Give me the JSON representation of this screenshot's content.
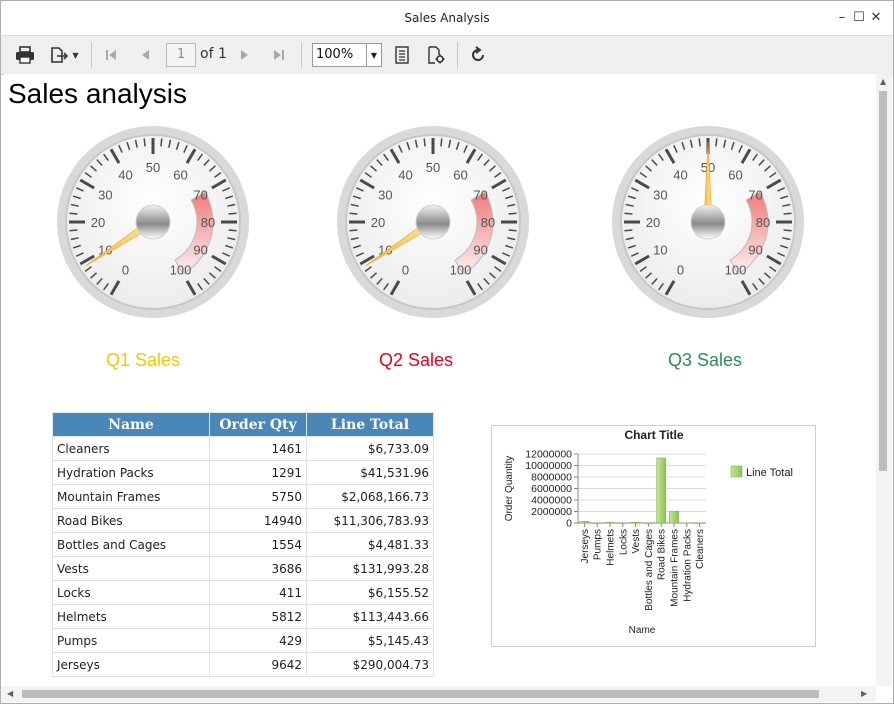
{
  "window": {
    "title": "Sales Analysis"
  },
  "toolbar": {
    "page_current": "1",
    "page_of": "of 1",
    "zoom": "100%"
  },
  "report": {
    "title": "Sales analysis",
    "gauges": [
      {
        "caption": "Q1 Sales",
        "value": 9,
        "caption_color": "#f5c800"
      },
      {
        "caption": "Q2 Sales",
        "value": 9,
        "caption_color": "#e4001b"
      },
      {
        "caption": "Q3 Sales",
        "value": 50,
        "caption_color": "#2e8b57"
      }
    ],
    "gauge_scale": {
      "min": 0,
      "max": 100,
      "labels": [
        "0",
        "10",
        "20",
        "30",
        "40",
        "50",
        "60",
        "70",
        "80",
        "90",
        "100"
      ],
      "range_start": 70,
      "range_end": 100
    },
    "table": {
      "headers": [
        "Name",
        "Order Qty",
        "Line Total"
      ],
      "rows": [
        [
          "Cleaners",
          "1461",
          "$6,733.09"
        ],
        [
          "Hydration Packs",
          "1291",
          "$41,531.96"
        ],
        [
          "Mountain Frames",
          "5750",
          "$2,068,166.73"
        ],
        [
          "Road Bikes",
          "14940",
          "$11,306,783.93"
        ],
        [
          "Bottles and Cages",
          "1554",
          "$4,481.33"
        ],
        [
          "Vests",
          "3686",
          "$131,993.28"
        ],
        [
          "Locks",
          "411",
          "$6,155.52"
        ],
        [
          "Helmets",
          "5812",
          "$113,443.66"
        ],
        [
          "Pumps",
          "429",
          "$5,145.43"
        ],
        [
          "Jerseys",
          "9642",
          "$290,004.73"
        ]
      ]
    }
  },
  "chart_data": {
    "type": "bar",
    "title": "Chart Title",
    "xlabel": "Name",
    "ylabel": "Order Quantity",
    "categories": [
      "Jerseys",
      "Pumps",
      "Helmets",
      "Locks",
      "Vests",
      "Bottles and Cages",
      "Road Bikes",
      "Mountain Frames",
      "Hydration Packs",
      "Cleaners"
    ],
    "series": [
      {
        "name": "Line Total",
        "values": [
          290004.73,
          5145.43,
          113443.66,
          6155.52,
          131993.28,
          4481.33,
          11306783.93,
          2068166.73,
          41531.96,
          6733.09
        ]
      }
    ],
    "yticks": [
      "0",
      "2000000",
      "4000000",
      "6000000",
      "8000000",
      "10000000",
      "12000000"
    ],
    "ylim": [
      0,
      12000000
    ],
    "legend": "right",
    "grid": true,
    "bar_color": "#8cc34e"
  }
}
